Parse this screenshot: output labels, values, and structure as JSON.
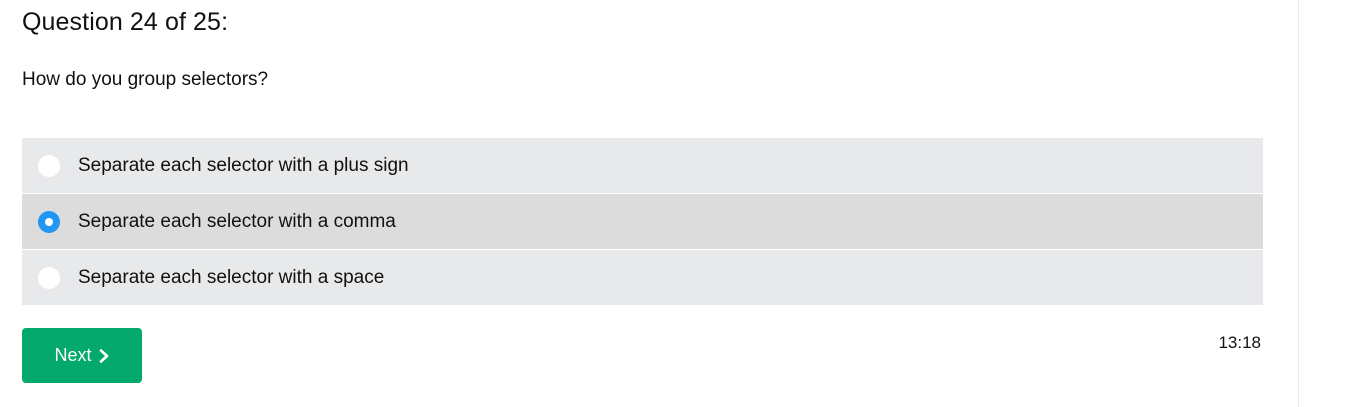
{
  "quiz": {
    "heading": "Question 24 of 25:",
    "question": "How do you group selectors?",
    "options": [
      {
        "label": "Separate each selector with a plus sign",
        "selected": false
      },
      {
        "label": "Separate each selector with a comma",
        "selected": true
      },
      {
        "label": "Separate each selector with a space",
        "selected": false
      }
    ],
    "next_label": "Next",
    "next_icon": "chevron-right-icon",
    "timer": "13:18"
  },
  "colors": {
    "option_bg": "#e8e9eb",
    "option_selected_bg": "#dcdcdd",
    "radio_checked": "#2196f3",
    "next_button_bg": "#04aa6d"
  }
}
